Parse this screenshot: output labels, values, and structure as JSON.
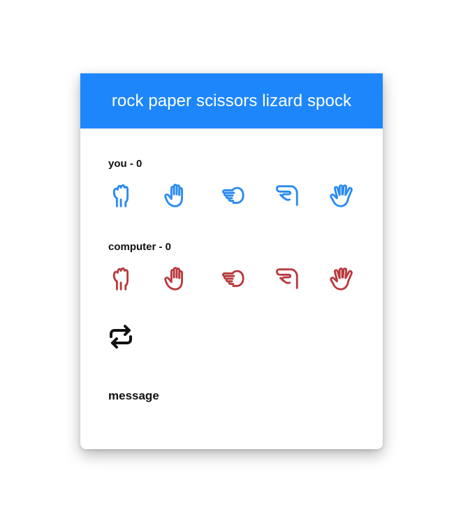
{
  "header": {
    "title": "rock paper scissors lizard spock"
  },
  "player": {
    "label": "you - 0",
    "color": "#2a8af0",
    "choices": [
      "rock-icon",
      "paper-icon",
      "scissors-icon",
      "lizard-icon",
      "spock-icon"
    ]
  },
  "computer": {
    "label": "computer - 0",
    "color": "#b83a3e",
    "choices": [
      "rock-icon",
      "paper-icon",
      "scissors-icon",
      "lizard-icon",
      "spock-icon"
    ]
  },
  "controls": {
    "reset_icon": "repeat-icon"
  },
  "status": {
    "message": "message"
  },
  "colors": {
    "header": "#1e86fb"
  }
}
